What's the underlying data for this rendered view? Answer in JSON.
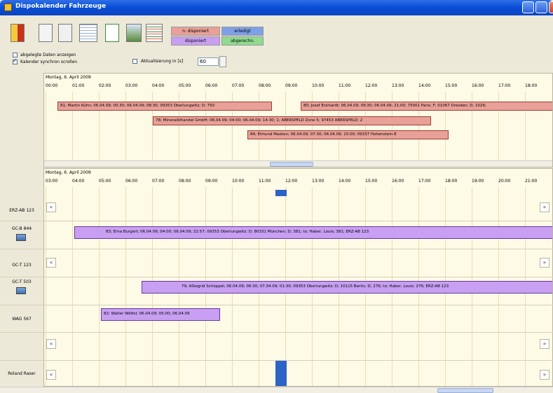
{
  "window": {
    "title": "Dispokalender Fahrzeuge"
  },
  "legend": {
    "nicht_disponiert": "n. disponiert",
    "erledigt": "erledigt",
    "disponiert": "disponiert",
    "abgerechn": "abgerechn."
  },
  "options": {
    "abgelegte_label": "abgelegte Daten anzeigen",
    "sync_label": "Kalender synchron scrollen",
    "aktualisierung_label": "Aktualisierung in [s]",
    "aktualisierung_value": "60"
  },
  "top_calendar": {
    "date": "Montag, 6. April 2009",
    "hours": [
      "00:00",
      "01:00",
      "02:00",
      "03:00",
      "04:00",
      "05:00",
      "06:00",
      "07:00",
      "08:00",
      "09:00",
      "10:00",
      "11:00",
      "12:00",
      "13:00",
      "14:00",
      "15:00",
      "16:00",
      "17:00",
      "18:00"
    ],
    "bars": [
      "81; Martin Kühn; 06.04.09; 00:30; 06.04.09; 08:30; 09353 Oberlungwitz; D; 750",
      "80; Josef Eckhardt; 06.04.09; 09:30; 06.04.09; 21:00; 75001 Paris; F; 01067 Dresden; D; 1029;",
      "78; Mineralölhandel GmbH; 06.04.09; 04:00; 06.04.09; 14:30; 1; ABERSPELD Zone 5; 97453 ABERSPELD; 2",
      "84; Elmund Maskon; 06.04.09; 07:30; 06.04.09; 15:00; 09337 Hohenstein-E"
    ]
  },
  "bottom_calendar": {
    "date": "Montag, 6. April 2009",
    "hours": [
      "03:00",
      "04:00",
      "05:00",
      "06:00",
      "07:00",
      "08:00",
      "09:00",
      "10:00",
      "11:00",
      "12:00",
      "13:00",
      "14:00",
      "15:00",
      "16:00",
      "17:00",
      "18:00",
      "19:00",
      "20:00",
      "21:00"
    ],
    "vehicles": [
      "ERZ-AB 123",
      "GC-B 844",
      "GC-T 123",
      "GC-T 503",
      "WAG 567",
      "",
      "Roland Raser"
    ],
    "bars": [
      "83; Erna Burgert; 06.04.09; 04:00; 06.04.09; 22:57; 09353 Oberlungwitz; D; 80331 München; D; 381; to; Haber, Louis; 381; ERZ-AB 123",
      "79; ASiegrid Schüppel; 06.04.09; 06:30; 07.04.09; 01:30; 09353 Oberlungwitz; D; 10115 Berlin; D; 276; to; Haber, Louis; 276; ERZ-AB 123",
      "82; Walter Wölfel; 06.04.09; 05:00; 06.04.09"
    ]
  },
  "nav": {
    "prev": "«",
    "next": "»"
  },
  "colors": {
    "nicht_disponiert": "#e8a098",
    "erledigt": "#7da0e8",
    "disponiert": "#c89ff2",
    "abgerechnet": "#8fdc8f"
  }
}
